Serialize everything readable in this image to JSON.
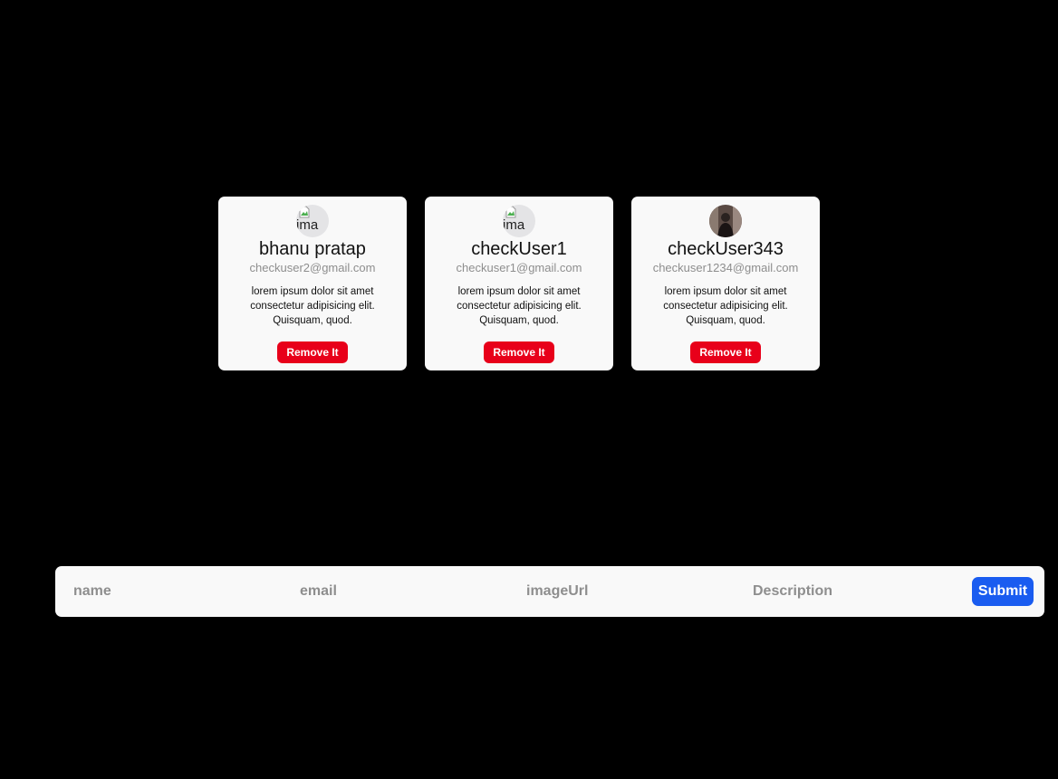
{
  "cards": [
    {
      "name": "bhanu pratap",
      "email": "checkuser2@gmail.com",
      "description": "lorem ipsum dolor sit amet consectetur adipisicing elit. Quisquam, quod.",
      "button_label": "Remove It",
      "image_alt": "ima"
    },
    {
      "name": "checkUser1",
      "email": "checkuser1@gmail.com",
      "description": "lorem ipsum dolor sit amet consectetur adipisicing elit. Quisquam, quod.",
      "button_label": "Remove It",
      "image_alt": "ima"
    },
    {
      "name": "checkUser343",
      "email": "checkuser1234@gmail.com",
      "description": "lorem ipsum dolor sit amet consectetur adipisicing elit. Quisquam, quod.",
      "button_label": "Remove It"
    }
  ],
  "form": {
    "name_placeholder": "name",
    "email_placeholder": "email",
    "image_placeholder": "imageUrl",
    "description_placeholder": "Description",
    "submit_label": "Submit"
  },
  "colors": {
    "background": "#000000",
    "card": "#f9f9f9",
    "remove_button": "#e8001a",
    "submit_button": "#1a5cf0"
  }
}
